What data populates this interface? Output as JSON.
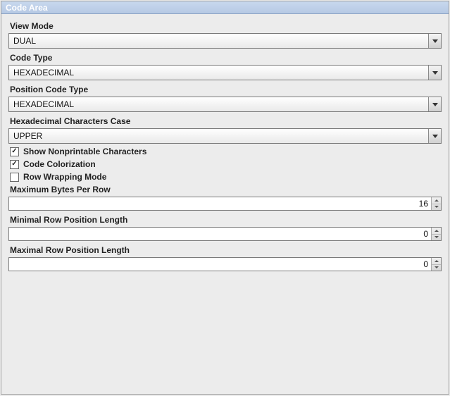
{
  "title": "Code Area",
  "fields": {
    "viewMode": {
      "label": "View Mode",
      "value": "DUAL"
    },
    "codeType": {
      "label": "Code Type",
      "value": "HEXADECIMAL"
    },
    "posCodeType": {
      "label": "Position Code Type",
      "value": "HEXADECIMAL"
    },
    "hexCase": {
      "label": "Hexadecimal Characters Case",
      "value": "UPPER"
    }
  },
  "checks": {
    "nonprint": {
      "label": "Show Nonprintable Characters",
      "checked": true
    },
    "colorize": {
      "label": "Code Colorization",
      "checked": true
    },
    "wrap": {
      "label": "Row Wrapping Mode",
      "checked": false
    }
  },
  "spinners": {
    "maxBytes": {
      "label": "Maximum Bytes Per Row",
      "value": "16"
    },
    "minRowPos": {
      "label": "Minimal Row Position Length",
      "value": "0"
    },
    "maxRowPos": {
      "label": "Maximal Row Position Length",
      "value": "0"
    }
  }
}
